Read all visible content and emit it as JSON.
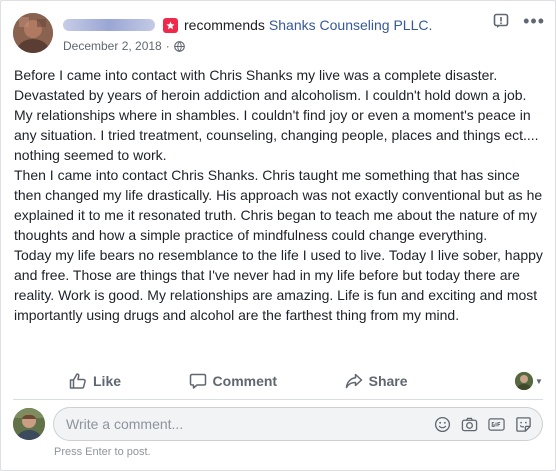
{
  "header": {
    "recommends_text": "recommends",
    "page_name": "Shanks Counseling PLLC.",
    "date": "December 2, 2018",
    "separator": "·"
  },
  "post": {
    "paragraphs": [
      "Before I came into contact with Chris Shanks my live was a complete disaster. Devastated by years of heroin addiction and alcoholism. I couldn't hold down a job. My relationships where in shambles. I couldn't find joy or even a moment's peace in any situation. I tried treatment, counseling, changing people, places and things ect.... nothing seemed to work.",
      "Then I came into contact Chris Shanks. Chris taught me something that has since then changed my life drastically. His approach was not exactly conventional but as he explained it to me it resonated truth. Chris began to teach me about the nature of my thoughts and how a simple practice of mindfulness could change everything.",
      "Today my life bears no resemblance to the life I used to live. Today I live sober, happy and free. Those are things that I've never had in my life before but today there are reality. Work is good. My relationships are amazing. Life is fun and exciting and most importantly using drugs and alcohol are the farthest thing from my mind."
    ]
  },
  "actions": {
    "like": "Like",
    "comment": "Comment",
    "share": "Share"
  },
  "comment_input": {
    "placeholder": "Write a comment...",
    "hint": "Press Enter to post."
  },
  "colors": {
    "link": "#365899",
    "recommend_badge": "#f0284a",
    "muted": "#606770"
  }
}
